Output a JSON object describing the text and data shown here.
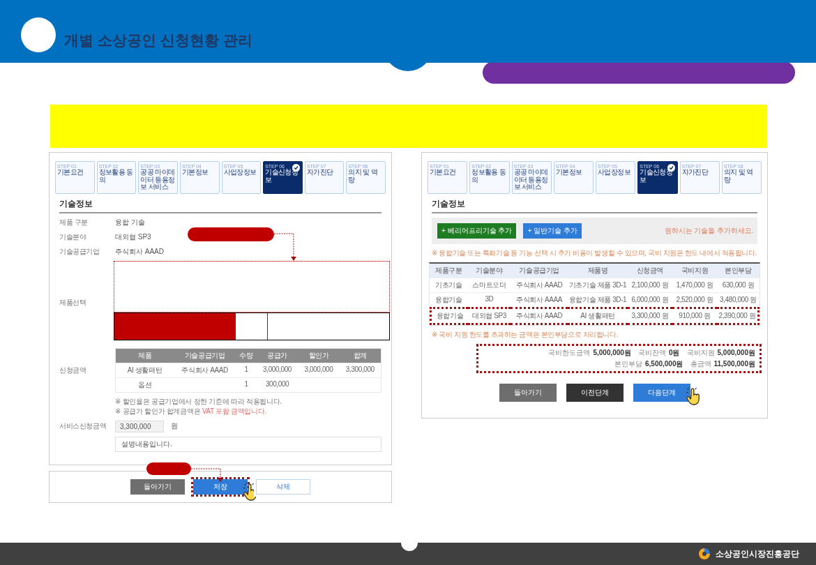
{
  "header": {
    "title": "개별 소상공인 신청현황 관리"
  },
  "left_screen": {
    "steps": [
      {
        "number": "STEP 01",
        "label": "기본요건",
        "selected": false
      },
      {
        "number": "STEP 02",
        "label": "정보활용 동의",
        "selected": false
      },
      {
        "number": "STEP 03",
        "label": "공공 마이데이터 등용정보 서비스",
        "selected": false
      },
      {
        "number": "STEP 04",
        "label": "기본정보",
        "selected": false
      },
      {
        "number": "STEP 05",
        "label": "사업장정보",
        "selected": false
      },
      {
        "number": "STEP 06",
        "label": "기술신청정보",
        "selected": true
      },
      {
        "number": "STEP 07",
        "label": "자가진단",
        "selected": false
      },
      {
        "number": "STEP 08",
        "label": "의지 및 역량",
        "selected": false
      }
    ],
    "heading": "기술정보",
    "fields": [
      {
        "label": "제품 구분",
        "value": "융합 기술"
      },
      {
        "label": "기술분야",
        "value": "대외협 SP3"
      },
      {
        "label": "기술공급기업",
        "value": "주식회사 AAAD"
      }
    ],
    "product_label": "제품선택",
    "amount": {
      "label": "신청금액",
      "columns": [
        "제품",
        "기술공급기업",
        "수량",
        "공급가",
        "할인가",
        "합계"
      ],
      "rows": [
        [
          "AI 생활패턴",
          "주식회사 AAAD",
          "1",
          "3,000,000",
          "3,000,000",
          "3,300,000"
        ],
        [
          "옵션",
          "",
          "1",
          "300,000",
          "",
          ""
        ]
      ],
      "notes": [
        {
          "text": "※ 할인율은 공급기업에서 정한 기준에 따라 적용됩니다."
        },
        {
          "text": "※ 공급가 할인가 합계금액은 ",
          "emphasis": "VAT 포함 금액입니다."
        }
      ]
    },
    "service_amount": {
      "label": "서비스신청금액",
      "value": "3,300,000",
      "unit": "원"
    },
    "memo": {
      "value": "설명내용입니다."
    },
    "buttons": [
      {
        "label": "돌아가기",
        "kind": "grey",
        "highlighted": false,
        "clicked": false
      },
      {
        "label": "저장",
        "kind": "blue",
        "highlighted": true,
        "clicked": true
      },
      {
        "label": "삭제",
        "kind": "white",
        "highlighted": false,
        "clicked": false
      }
    ]
  },
  "right_screen": {
    "steps": [
      {
        "number": "STEP 01",
        "label": "기본요건",
        "selected": false
      },
      {
        "number": "STEP 02",
        "label": "정보활용 동의",
        "selected": false
      },
      {
        "number": "STEP 03",
        "label": "공공 마이데이터 등용정보 서비스",
        "selected": false
      },
      {
        "number": "STEP 04",
        "label": "기본정보",
        "selected": false
      },
      {
        "number": "STEP 05",
        "label": "사업장정보",
        "selected": false
      },
      {
        "number": "STEP 06",
        "label": "기술신청정보",
        "selected": true
      },
      {
        "number": "STEP 07",
        "label": "자가진단",
        "selected": false
      },
      {
        "number": "STEP 08",
        "label": "의지 및 역량",
        "selected": false
      }
    ],
    "heading": "기술정보",
    "add_buttons": [
      {
        "label": "+ 베리어프리기술 추가",
        "kind": "green"
      },
      {
        "label": "+ 일반기술 추가",
        "kind": "blue"
      }
    ],
    "toolbar_note": "원하시는 기술을 추가하세요.",
    "warning": "※ 융합기술 또는 특화기술 등 기능 선택 시 추가 비용이 발생할 수 있으며, 국비 지원은 한도 내에서 적용됩니다.",
    "columns": [
      "제품구분",
      "기술분야",
      "기술공급기업",
      "제품명",
      "신청금액",
      "국비지원",
      "본인부담"
    ],
    "rows": [
      {
        "cells": [
          "기초기술",
          "스마트오더",
          "주식회사 AAAD",
          "기초기술 제품 3D-1",
          "2,100,000 원",
          "1,470,000 원",
          "630,000 원"
        ],
        "highlighted": false
      },
      {
        "cells": [
          "융합기술",
          "3D",
          "주식회사 AAAA",
          "융합기술 제품 3D-1",
          "6,000,000 원",
          "2,520,000 원",
          "3,480,000 원"
        ],
        "highlighted": false
      },
      {
        "cells": [
          "융합기술",
          "대외협 SP3",
          "주식회사 AAAD",
          "AI 생활패턴",
          "3,300,000 원",
          "910,000 원",
          "2,390,000 원"
        ],
        "highlighted": true
      }
    ],
    "table_note": "※ 국비 지원 한도를 초과하는 금액은 본인부담으로 처리됩니다.",
    "summary": [
      {
        "label": "국비한도금액",
        "value": "5,000,000원"
      },
      {
        "label": "국비잔액",
        "value": "0원"
      },
      {
        "label": "국비지원",
        "value": "5,000,000원"
      },
      {
        "label": "본인부담",
        "value": "6,500,000원"
      },
      {
        "label": "총금액",
        "value": "11,500,000원"
      }
    ],
    "buttons": [
      {
        "label": "돌아가기",
        "kind": "grey",
        "clicked": false
      },
      {
        "label": "이전단계",
        "kind": "dark",
        "clicked": false
      },
      {
        "label": "다음단계",
        "kind": "blue",
        "clicked": true
      }
    ]
  },
  "footer": {
    "org": "소상공인시장진흥공단"
  }
}
